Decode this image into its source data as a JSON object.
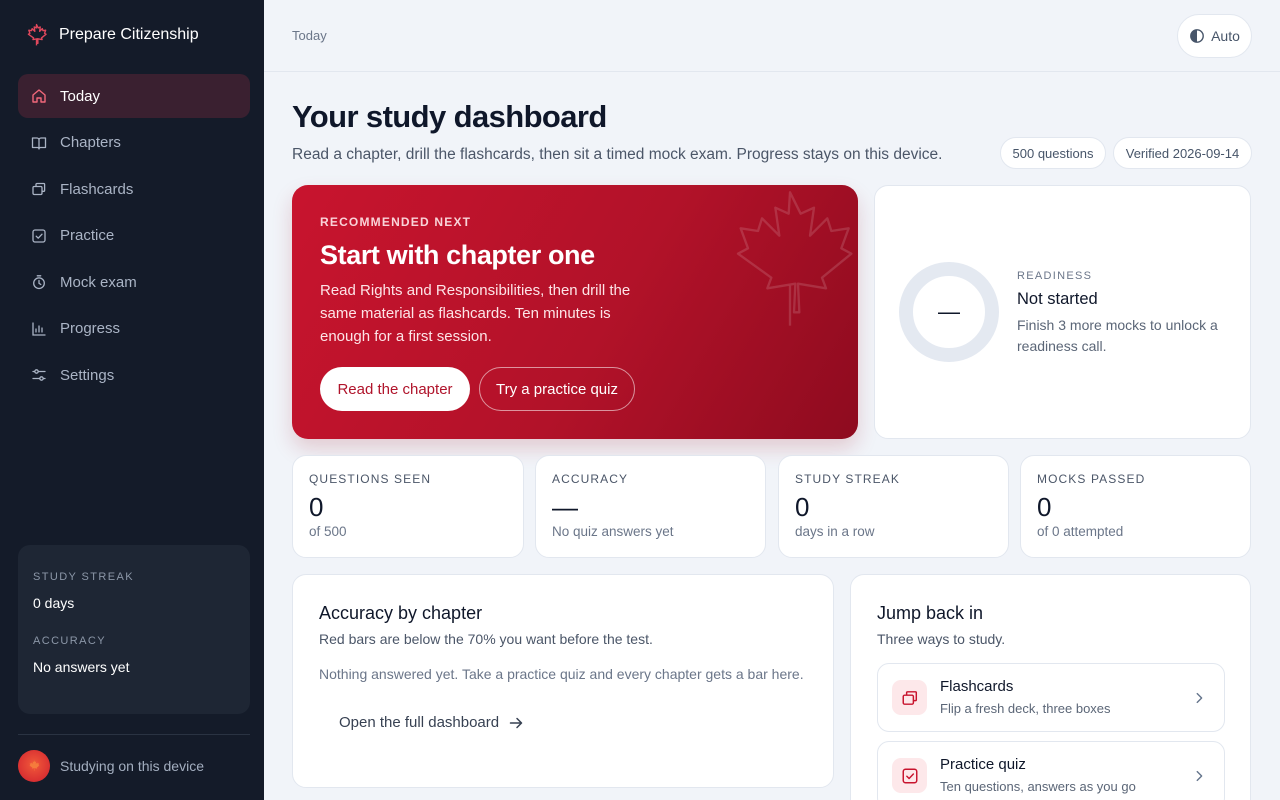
{
  "app": {
    "name": "Prepare Citizenship"
  },
  "colors": {
    "accent": "#c8142e",
    "sidebar_bg": "#141b29",
    "active_nav_bg": "#3a2030"
  },
  "sidebar": {
    "items": [
      {
        "label": "Today",
        "icon": "home-icon",
        "active": true
      },
      {
        "label": "Chapters",
        "icon": "book-icon"
      },
      {
        "label": "Flashcards",
        "icon": "cards-icon"
      },
      {
        "label": "Practice",
        "icon": "checkbox-icon"
      },
      {
        "label": "Mock exam",
        "icon": "stopwatch-icon"
      },
      {
        "label": "Progress",
        "icon": "bar-chart-icon"
      },
      {
        "label": "Settings",
        "icon": "sliders-icon"
      }
    ],
    "stats": {
      "streak_label": "STUDY STREAK",
      "streak_value": "0 days",
      "accuracy_label": "ACCURACY",
      "accuracy_value": "No answers yet"
    },
    "footer_text": "Studying on this device"
  },
  "header": {
    "breadcrumb": "Today",
    "theme_label": "Auto"
  },
  "page": {
    "title": "Your study dashboard",
    "subtitle": "Read a chapter, drill the flashcards, then sit a timed mock exam. Progress stays on this device.",
    "pills": [
      "500 questions",
      "Verified 2026-09-14"
    ]
  },
  "hero": {
    "eyebrow": "RECOMMENDED NEXT",
    "title": "Start with chapter one",
    "body": "Read Rights and Responsibilities, then drill the same material as flashcards. Ten minutes is enough for a first session.",
    "primary_button": "Read the chapter",
    "secondary_button": "Try a practice quiz"
  },
  "readiness": {
    "ring_value": "—",
    "progress": 0,
    "label": "READINESS",
    "status": "Not started",
    "description": "Finish 3 more mocks to unlock a readiness call."
  },
  "stats": [
    {
      "label": "QUESTIONS SEEN",
      "value": "0",
      "sub": "of 500"
    },
    {
      "label": "ACCURACY",
      "value": "—",
      "sub": "No quiz answers yet"
    },
    {
      "label": "STUDY STREAK",
      "value": "0",
      "sub": "days in a row"
    },
    {
      "label": "MOCKS PASSED",
      "value": "0",
      "sub": "of 0 attempted"
    }
  ],
  "accuracy_card": {
    "title": "Accuracy by chapter",
    "subtitle": "Red bars are below the 70% you want before the test.",
    "empty_text": "Nothing answered yet. Take a practice quiz and every chapter gets a bar here.",
    "link": "Open the full dashboard"
  },
  "jump": {
    "title": "Jump back in",
    "subtitle": "Three ways to study.",
    "items": [
      {
        "title": "Flashcards",
        "desc": "Flip a fresh deck, three boxes",
        "icon": "cards-icon"
      },
      {
        "title": "Practice quiz",
        "desc": "Ten questions, answers as you go",
        "icon": "checkbox-icon"
      }
    ]
  }
}
